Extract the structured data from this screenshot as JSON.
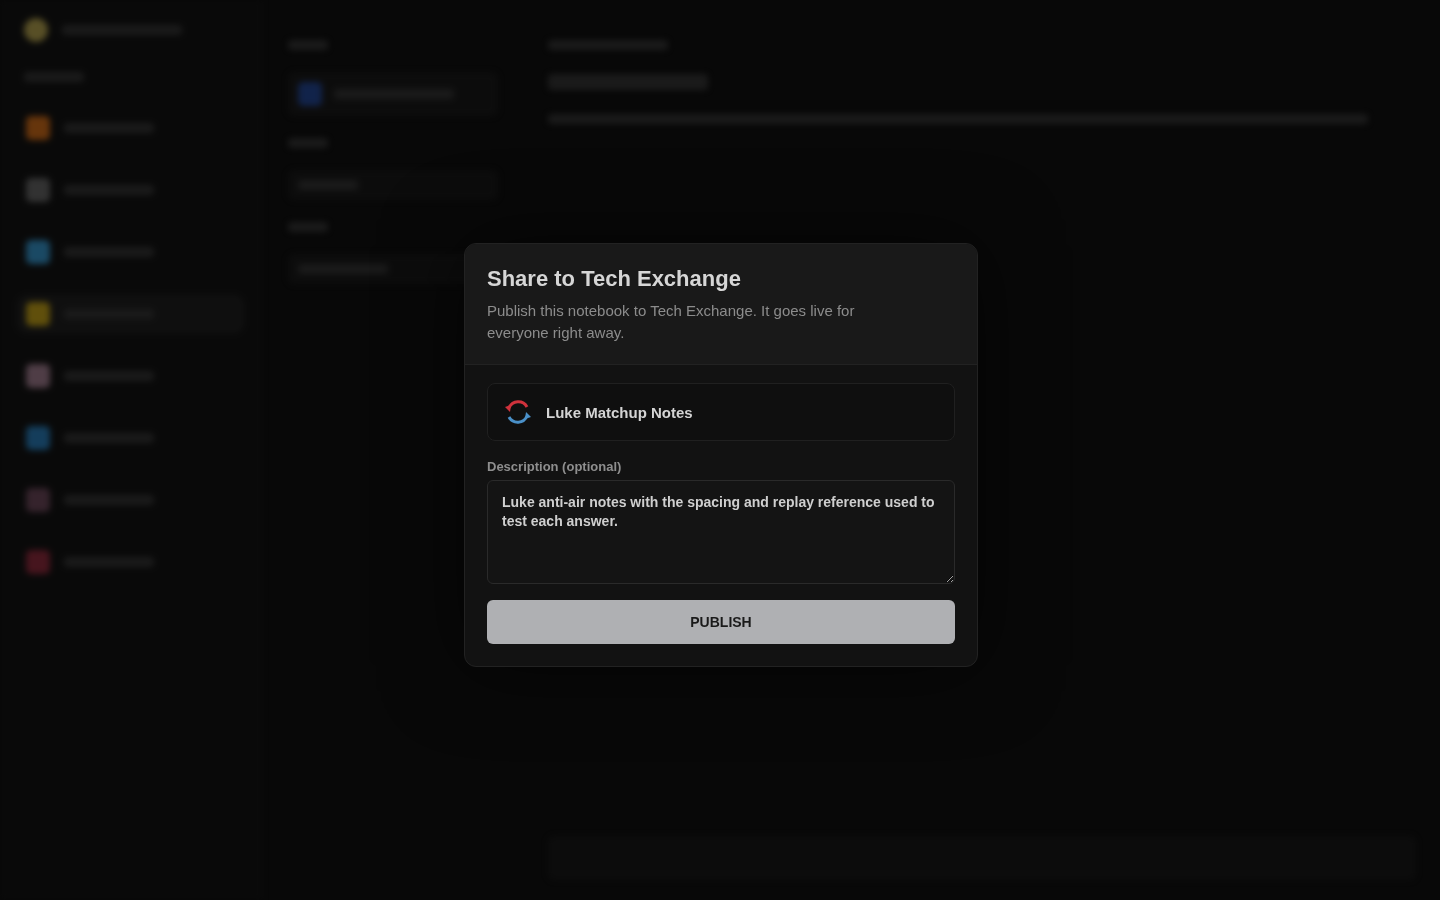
{
  "dialog": {
    "title": "Share to Tech Exchange",
    "subtitle": "Publish this notebook to Tech Exchange. It goes live for everyone right away.",
    "notebook": {
      "name": "Luke Matchup Notes"
    },
    "description": {
      "label": "Description (optional)",
      "value": "Luke anti-air notes with the spacing and replay reference used to test each answer."
    },
    "publish_button": {
      "label": "PUBLISH"
    }
  }
}
